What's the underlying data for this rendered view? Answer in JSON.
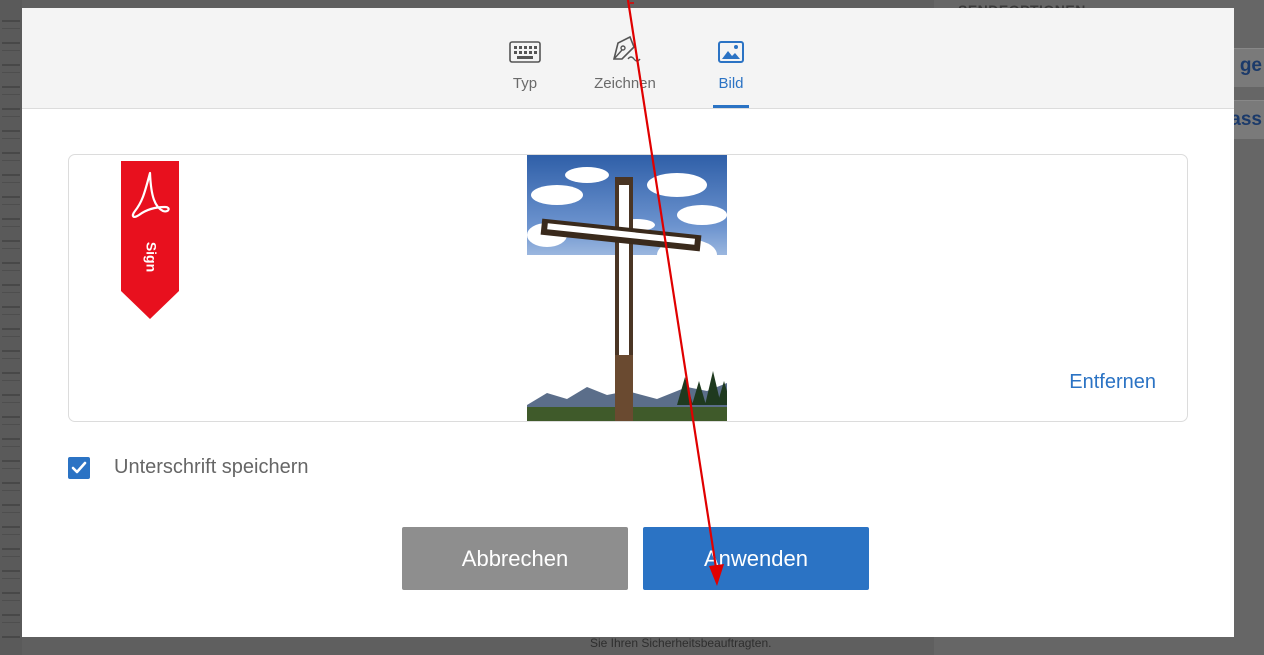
{
  "tabs": [
    {
      "label": "Typ",
      "icon": "keyboard-icon",
      "active": false
    },
    {
      "label": "Zeichnen",
      "icon": "pen-nib-icon",
      "active": false
    },
    {
      "label": "Bild",
      "icon": "image-icon",
      "active": true
    }
  ],
  "preview": {
    "badge_text": "Sign",
    "remove_label": "Entfernen"
  },
  "save_signature": {
    "label": "Unterschrift speichern",
    "checked": true
  },
  "buttons": {
    "cancel": "Abbrechen",
    "apply": "Anwenden"
  },
  "background": {
    "right_heading": "SENDEOPTIONEN",
    "right_snippet_1": "ge",
    "right_snippet_2": "ass",
    "bottom_text": "Sie Ihren Sicherheitsbeauftragten."
  },
  "colors": {
    "accent": "#2b73c4",
    "cancel": "#8e8e8e",
    "badge": "#e8101e",
    "annotation_arrow": "#e00000"
  }
}
